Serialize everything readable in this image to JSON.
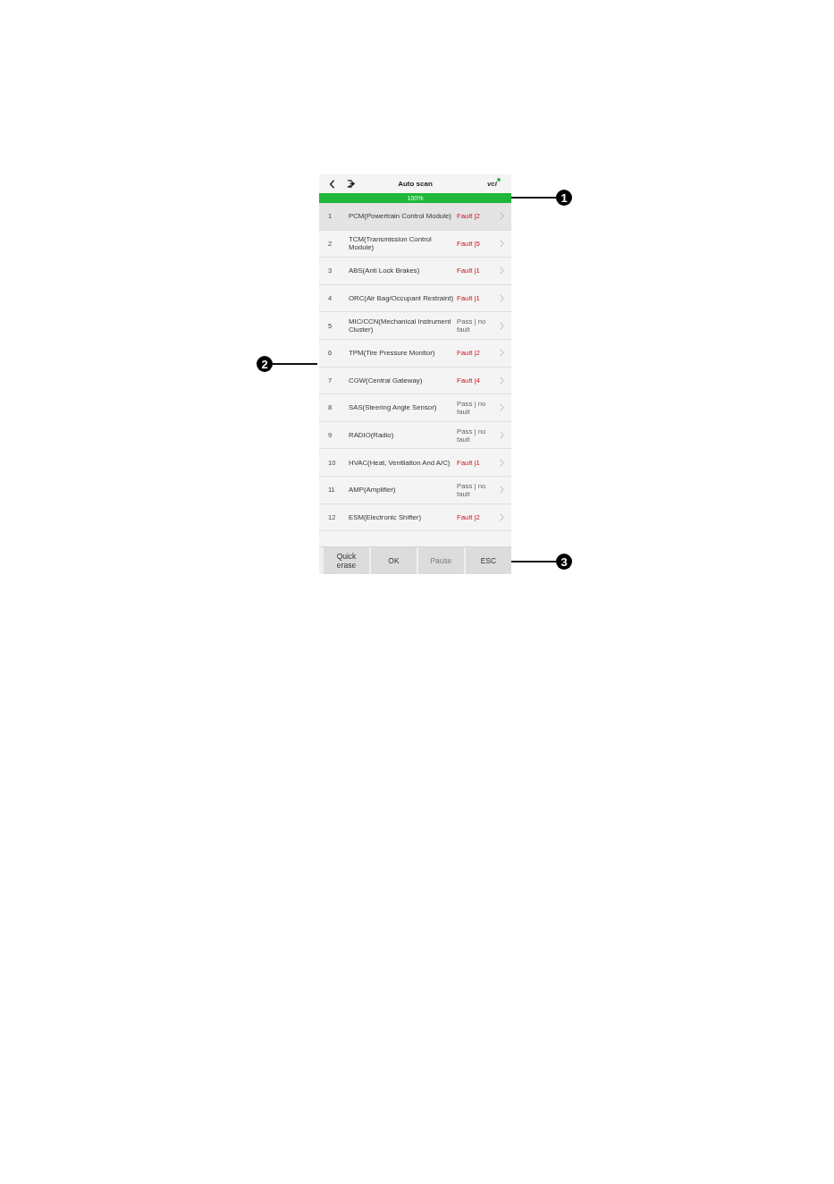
{
  "header": {
    "title": "Auto scan",
    "vci_label": "vci",
    "vci_connected": true
  },
  "progress": {
    "label": "100%",
    "level": 1
  },
  "modules": [
    {
      "number": "1",
      "name": "PCM(Powertrain Control Module)",
      "status": "Fault |2",
      "kind": "fault",
      "selected": true
    },
    {
      "number": "2",
      "name": "TCM(Transmission Control Module)",
      "status": "Fault |5",
      "kind": "fault",
      "selected": false
    },
    {
      "number": "3",
      "name": "ABS(Anti Lock Brakes)",
      "status": "Fault |1",
      "kind": "fault",
      "selected": false
    },
    {
      "number": "4",
      "name": "ORC(Air Bag/Occupant Restraint)",
      "status": "Fault |1",
      "kind": "fault",
      "selected": false
    },
    {
      "number": "5",
      "name": "MIC/CCN(Mechanical Instrument Cluster)",
      "status": "Pass | no fault",
      "kind": "pass",
      "selected": false
    },
    {
      "number": "6",
      "name": "TPM(Tire Pressure Monitor)",
      "status": "Fault |2",
      "kind": "fault",
      "selected": false
    },
    {
      "number": "7",
      "name": "CGW(Central Gateway)",
      "status": "Fault |4",
      "kind": "fault",
      "selected": false
    },
    {
      "number": "8",
      "name": "SAS(Steering Angle Sensor)",
      "status": "Pass | no fault",
      "kind": "pass",
      "selected": false
    },
    {
      "number": "9",
      "name": "RADIO(Radio)",
      "status": "Pass | no fault",
      "kind": "pass",
      "selected": false
    },
    {
      "number": "10",
      "name": "HVAC(Heat, Ventilation And A/C)",
      "status": "Fault |1",
      "kind": "fault",
      "selected": false
    },
    {
      "number": "11",
      "name": "AMP(Amplifier)",
      "status": "Pass | no fault",
      "kind": "pass",
      "selected": false
    },
    {
      "number": "12",
      "name": "ESM(Electronic Shifter)",
      "status": "Fault |2",
      "kind": "fault",
      "selected": false
    }
  ],
  "buttons": [
    {
      "label": "Quick erase",
      "disabled": false
    },
    {
      "label": "OK",
      "disabled": false
    },
    {
      "label": "Pause",
      "disabled": true
    },
    {
      "label": "ESC",
      "disabled": false
    }
  ],
  "callouts": [
    "1",
    "2",
    "3"
  ]
}
